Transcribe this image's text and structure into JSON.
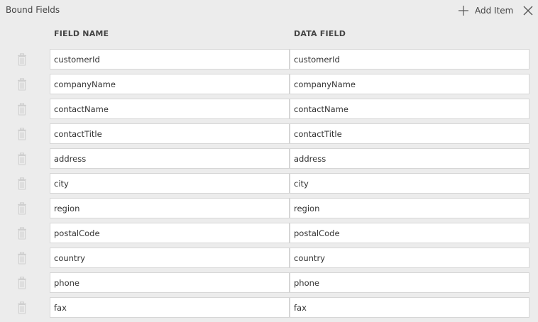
{
  "panel": {
    "title": "Bound Fields",
    "add_item_label": "Add Item"
  },
  "columns": {
    "field_name": "FIELD NAME",
    "data_field": "DATA FIELD"
  },
  "rows": [
    {
      "field_name": "customerId",
      "data_field": "customerId"
    },
    {
      "field_name": "companyName",
      "data_field": "companyName"
    },
    {
      "field_name": "contactName",
      "data_field": "contactName"
    },
    {
      "field_name": "contactTitle",
      "data_field": "contactTitle"
    },
    {
      "field_name": "address",
      "data_field": "address"
    },
    {
      "field_name": "city",
      "data_field": "city"
    },
    {
      "field_name": "region",
      "data_field": "region"
    },
    {
      "field_name": "postalCode",
      "data_field": "postalCode"
    },
    {
      "field_name": "country",
      "data_field": "country"
    },
    {
      "field_name": "phone",
      "data_field": "phone"
    },
    {
      "field_name": "fax",
      "data_field": "fax"
    }
  ],
  "icons": {
    "add": "plus-icon",
    "close": "close-icon",
    "delete": "trash-icon"
  },
  "colors": {
    "background": "#ececec",
    "cell_background": "#ffffff",
    "cell_border": "#d6d6d6",
    "icon": "#555555",
    "trash_icon": "#cfcfcf"
  }
}
